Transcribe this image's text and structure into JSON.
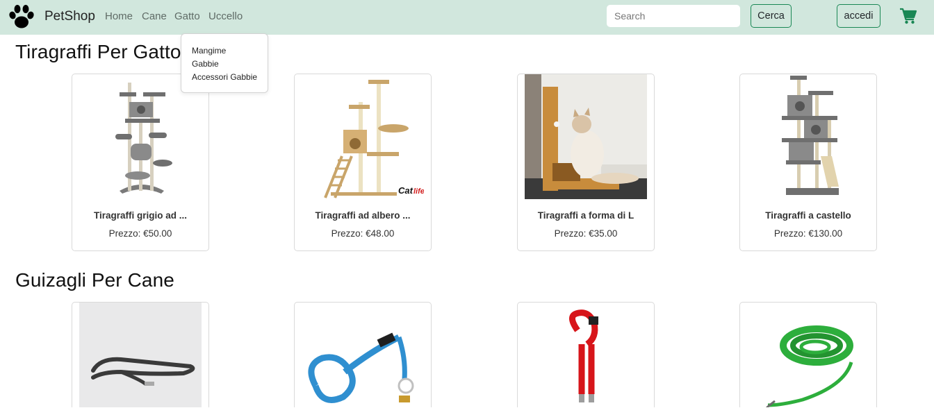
{
  "navbar": {
    "brand": "PetShop",
    "brand_icon": "paw-icon",
    "links": [
      "Home",
      "Cane",
      "Gatto",
      "Uccello"
    ],
    "search_placeholder": "Search",
    "search_button": "Cerca",
    "login_button": "accedi",
    "cart_icon": "shopping-cart-icon",
    "accent_color": "#198754",
    "background_color": "#d1e7dd"
  },
  "dropdown": {
    "items": [
      "Mangime",
      "Gabbie",
      "Accessori Gabbie"
    ]
  },
  "sections": [
    {
      "title": "Tiragraffi Per Gatto",
      "products": [
        {
          "name": "Tiragraffi grigio ad ...",
          "price": "Prezzo: €50.00",
          "image": "grey cat tree"
        },
        {
          "name": "Tiragraffi ad albero ...",
          "price": "Prezzo: €48.00",
          "image": "beige cat tree with ladder",
          "image_logo": "Catlife"
        },
        {
          "name": "Tiragraffi a forma di L",
          "price": "Prezzo: €35.00",
          "image": "cat with L-shaped scratcher"
        },
        {
          "name": "Tiragraffi a castello",
          "price": "Prezzo: €130.00",
          "image": "grey castle cat tree"
        }
      ]
    },
    {
      "title": "Guizagli Per Cane",
      "products": [
        {
          "image": "dark grey leash"
        },
        {
          "image": "blue leash"
        },
        {
          "image": "red leash"
        },
        {
          "image": "green long line leash"
        }
      ]
    }
  ]
}
